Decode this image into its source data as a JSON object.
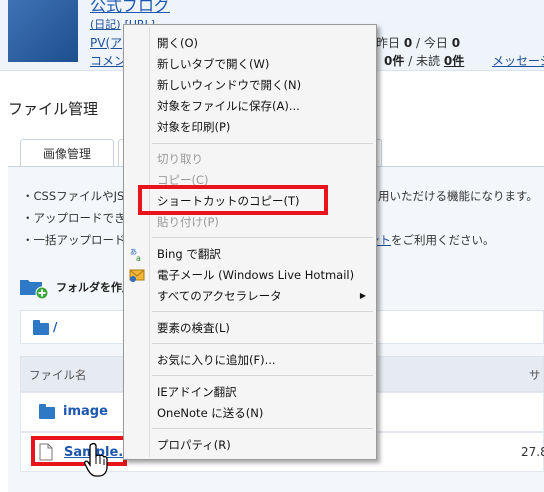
{
  "header": {
    "blog_title": "公式ブログ",
    "diary_link": "(日記)",
    "url_link": "[URL]",
    "pv_label": "PV(ア",
    "pv_stats_label": "昨日",
    "pv_yesterday": "0",
    "pv_today_label": "/ 今日",
    "pv_today": "0",
    "comment_label": "コメント",
    "comment_count": "0件",
    "unread_label": "/ 未読",
    "unread_count": "0件",
    "message_link": "メッセージ"
  },
  "page_title": "ファイル管理",
  "tabs": [
    "画像管理"
  ],
  "info_lines": [
    "・CSSファイルやJS",
    "・アップロードできる",
    "・一括アップロードや"
  ],
  "info_tail_1": "用いただける機能になります。",
  "info_tail_3_link": "ント",
  "info_tail_3": "をご利用ください。",
  "folder_create_label": "フォルダを作成",
  "current_path": "/",
  "table": {
    "col_name": "ファイル名",
    "col_size_partial": "サ",
    "rows": [
      {
        "name": "image",
        "size": ""
      },
      {
        "name": "Sample.",
        "size": "27.8"
      }
    ]
  },
  "context_menu": {
    "items": [
      {
        "label": "開く(O)",
        "disabled": false
      },
      {
        "label": "新しいタブで開く(W)",
        "disabled": false
      },
      {
        "label": "新しいウィンドウで開く(N)",
        "disabled": false
      },
      {
        "label": "対象をファイルに保存(A)...",
        "disabled": false
      },
      {
        "label": "対象を印刷(P)",
        "disabled": false
      },
      {
        "label": "切り取り",
        "disabled": true
      },
      {
        "label": "コピー(C)",
        "disabled": true
      },
      {
        "label": "ショートカットのコピー(T)",
        "disabled": false
      },
      {
        "label": "貼り付け(P)",
        "disabled": true
      },
      {
        "label": "Bing で翻訳",
        "disabled": false
      },
      {
        "label": "電子メール (Windows Live Hotmail)",
        "disabled": false
      },
      {
        "label": "すべてのアクセラレータ",
        "disabled": false
      },
      {
        "label": "要素の検査(L)",
        "disabled": false
      },
      {
        "label": "お気に入りに追加(F)...",
        "disabled": false
      },
      {
        "label": "IEアドイン翻訳",
        "disabled": false
      },
      {
        "label": "OneNote に送る(N)",
        "disabled": false
      },
      {
        "label": "プロパティ(R)",
        "disabled": false
      }
    ],
    "submenu_arrow": "▶"
  },
  "colors": {
    "highlight": "#e8141b",
    "link": "#1d4f9a",
    "folder": "#2e79c6"
  }
}
